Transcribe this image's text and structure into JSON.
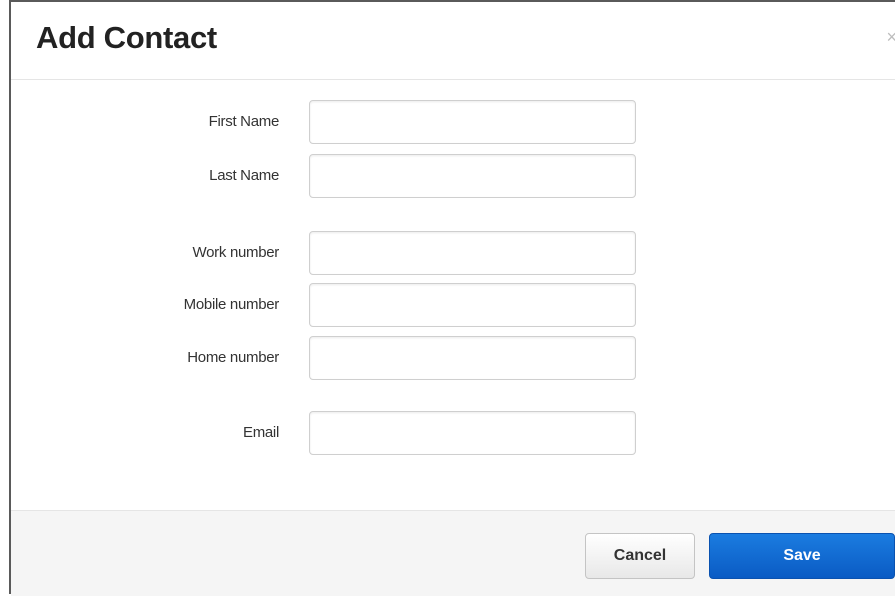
{
  "dialog": {
    "title": "Add Contact",
    "close_label": "×"
  },
  "form": {
    "fields": [
      {
        "label": "First Name",
        "value": "",
        "placeholder": ""
      },
      {
        "label": "Last Name",
        "value": "",
        "placeholder": ""
      },
      {
        "label": "Work number",
        "value": "",
        "placeholder": ""
      },
      {
        "label": "Mobile number",
        "value": "",
        "placeholder": ""
      },
      {
        "label": "Home number",
        "value": "",
        "placeholder": ""
      },
      {
        "label": "Email",
        "value": "",
        "placeholder": ""
      }
    ]
  },
  "footer": {
    "cancel_label": "Cancel",
    "save_label": "Save"
  },
  "colors": {
    "primary": "#0a66d4",
    "footer_bg": "#f5f5f5",
    "border": "#cfcfcf"
  }
}
